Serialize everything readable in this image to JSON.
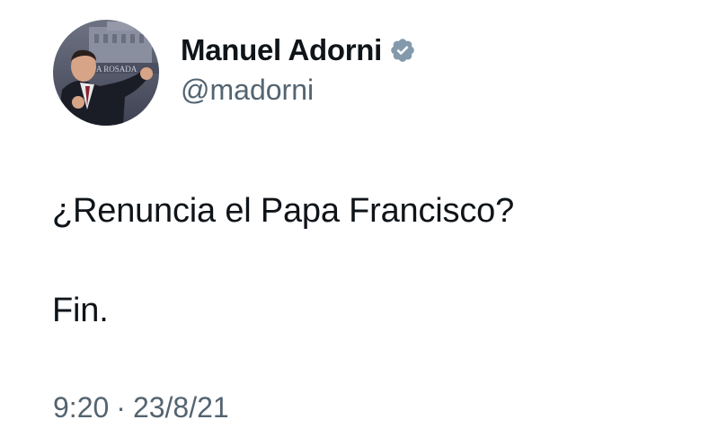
{
  "tweet": {
    "author": {
      "display_name": "Manuel Adorni",
      "handle": "@madorni",
      "verified": true,
      "verified_icon": "verified-badge-icon",
      "avatar_caption": "A ROSADA"
    },
    "text_line1": "¿Renuncia el Papa Francisco?",
    "text_line2": "Fin.",
    "time": "9:20",
    "separator": "·",
    "date": "23/8/21"
  },
  "colors": {
    "text_primary": "#0f1419",
    "text_secondary": "#536471",
    "verified_badge": "#829aab",
    "background": "#ffffff"
  }
}
